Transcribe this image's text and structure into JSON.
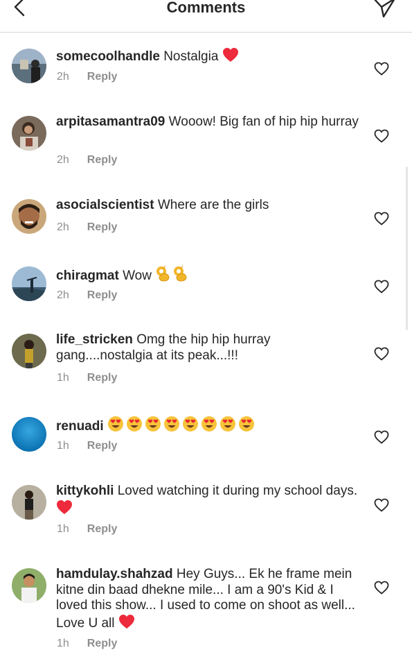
{
  "header": {
    "title": "Comments",
    "back_icon": "chevron-left-icon",
    "send_icon": "paper-plane-icon"
  },
  "comments": [
    {
      "username": "somecoolhandle",
      "text": "Nostalgia",
      "emojis": [
        "red-heart"
      ],
      "time": "2h",
      "reply": "Reply"
    },
    {
      "username": "arpitasamantra09",
      "text": "Wooow! Big fan of hip hip hurray",
      "emojis": [],
      "time": "2h",
      "reply": "Reply"
    },
    {
      "username": "asocialscientist",
      "text": "Where are the girls",
      "emojis": [],
      "time": "2h",
      "reply": "Reply"
    },
    {
      "username": "chiragmat",
      "text": "Wow",
      "emojis": [
        "ok-hand",
        "ok-hand"
      ],
      "time": "2h",
      "reply": "Reply"
    },
    {
      "username": "life_stricken",
      "text": "Omg the hip hip hurray gang....nostalgia at its peak...!!!",
      "emojis": [],
      "time": "1h",
      "reply": "Reply"
    },
    {
      "username": "renuadi",
      "text": "",
      "emojis": [
        "heart-eyes",
        "heart-eyes",
        "heart-eyes",
        "heart-eyes",
        "heart-eyes",
        "heart-eyes",
        "heart-eyes",
        "heart-eyes"
      ],
      "time": "1h",
      "reply": "Reply"
    },
    {
      "username": "kittykohli",
      "text": "Loved watching it during my school days.",
      "emojis": [
        "red-heart"
      ],
      "time": "1h",
      "reply": "Reply"
    },
    {
      "username": "hamdulay.shahzad",
      "text": "Hey Guys... Ek he frame mein kitne din baad dhekne mile... I am a 90's Kid & I loved this show... I used to come on shoot as well... Love U all",
      "emojis": [
        "red-heart"
      ],
      "time": "1h",
      "reply": "Reply"
    }
  ],
  "colors": {
    "text": "#262626",
    "meta": "#8e8e8e",
    "heart_emoji": "#ed2a3b",
    "divider": "#d6d6d6"
  }
}
